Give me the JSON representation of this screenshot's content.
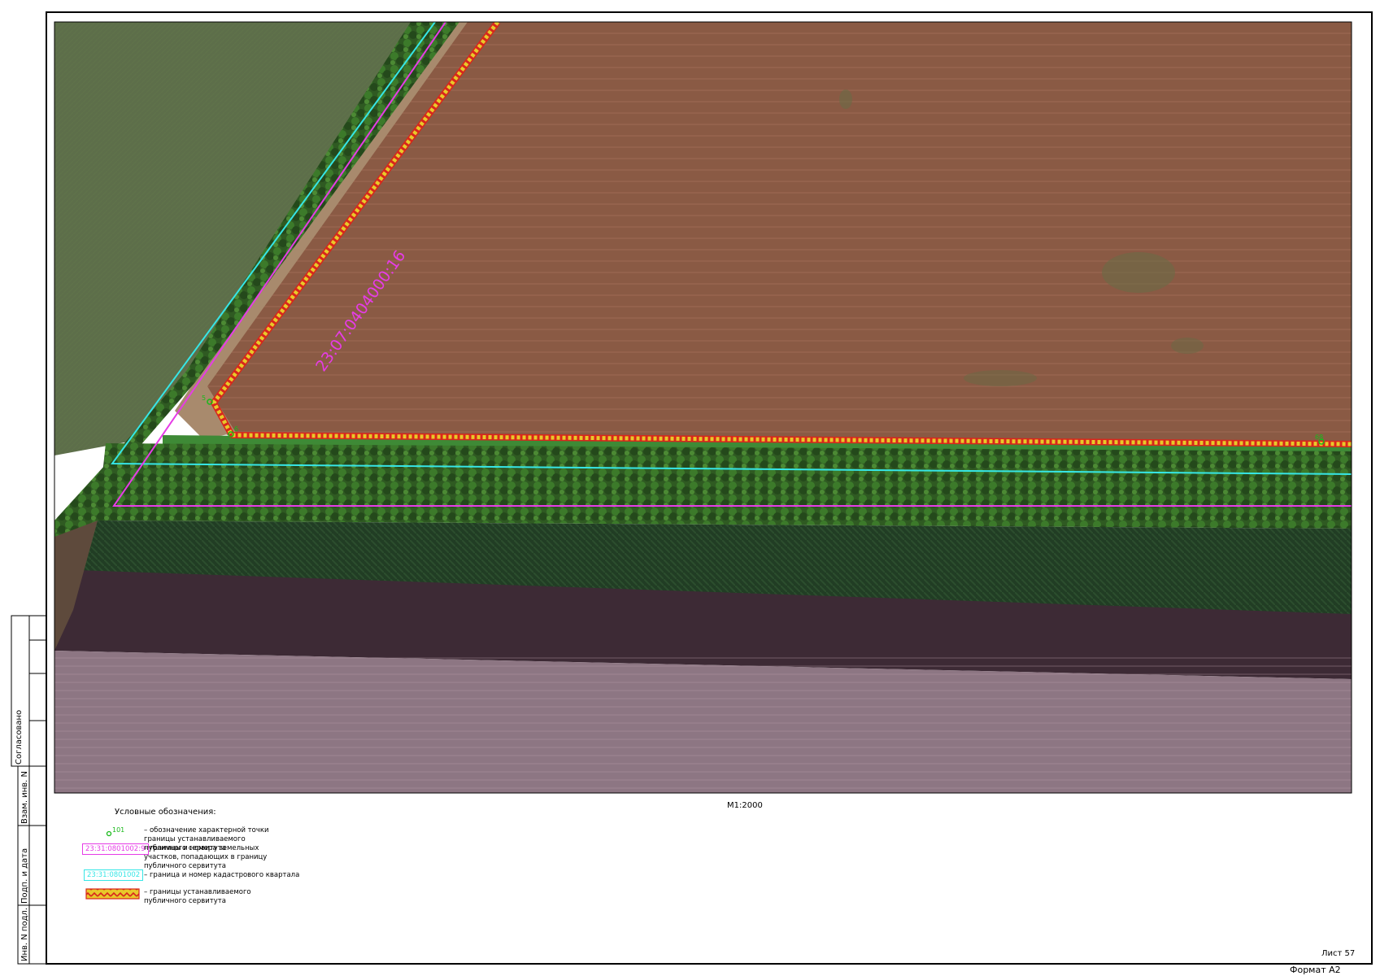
{
  "map": {
    "parcel_label": "23:07:0404000:16",
    "corner_point_labels": [
      "5",
      "6",
      "68"
    ]
  },
  "legend": {
    "title": "Условные обозначения:",
    "point_sample_label": "101",
    "items": [
      {
        "symbol": "point",
        "text": "– обозначение характерной точки границы устанавливаемого публичного сервитута"
      },
      {
        "symbol": "magenta-box",
        "box_label": "23:31:0801002:9",
        "text": "– границы и номера земельных участков, попадающих в границу публичного сервитута"
      },
      {
        "symbol": "cyan-box",
        "box_label": "23:31:0801002",
        "text": "– граница и номер кадастрового квартала"
      },
      {
        "symbol": "hatched-box",
        "box_label": "",
        "text": "– границы устанавливаемого публичного сервитута"
      }
    ]
  },
  "scale": "М1:2000",
  "sheet_number": "Лист 57",
  "format": "Формат  А2",
  "side_stamp": {
    "agreed": "Согласовано",
    "inv_replace": "Взам. инв. N",
    "signature_date": "Подп. и дата",
    "inv_original": "Инв. N подл."
  },
  "colors": {
    "parcel_boundary": "#e63ce6",
    "quarter_boundary": "#36e6e6",
    "servitude_fill": "#e8c92a",
    "servitude_edge": "#d8261c",
    "point_marker": "#19b91a"
  }
}
